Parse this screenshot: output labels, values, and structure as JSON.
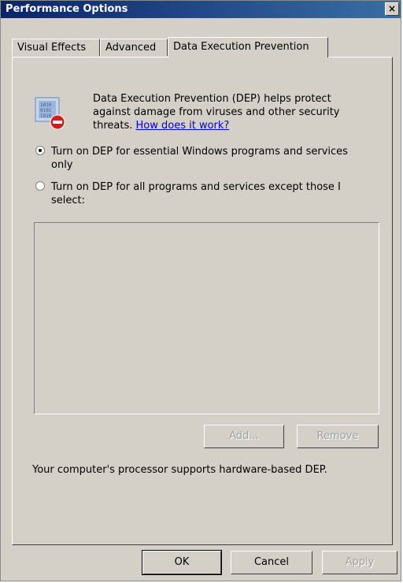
{
  "window": {
    "title": "Performance Options",
    "close_glyph": "×"
  },
  "tabs": [
    {
      "label": "Visual Effects"
    },
    {
      "label": "Advanced"
    },
    {
      "label": "Data Execution Prevention",
      "active": true
    }
  ],
  "dep": {
    "description": "Data Execution Prevention (DEP) helps protect against damage from viruses and other security threats.",
    "link_text": "How does it work?",
    "options": [
      {
        "label": "Turn on DEP for essential Windows programs and services only",
        "checked": true
      },
      {
        "label": "Turn on DEP for all programs and services except those I select:",
        "checked": false
      }
    ],
    "list_items": [],
    "add_label": "Add...",
    "remove_label": "Remove",
    "status_text": "Your computer's processor supports hardware-based DEP."
  },
  "footer": {
    "ok_label": "OK",
    "cancel_label": "Cancel",
    "apply_label": "Apply"
  },
  "icon": {
    "name": "dep-shield-icon"
  }
}
